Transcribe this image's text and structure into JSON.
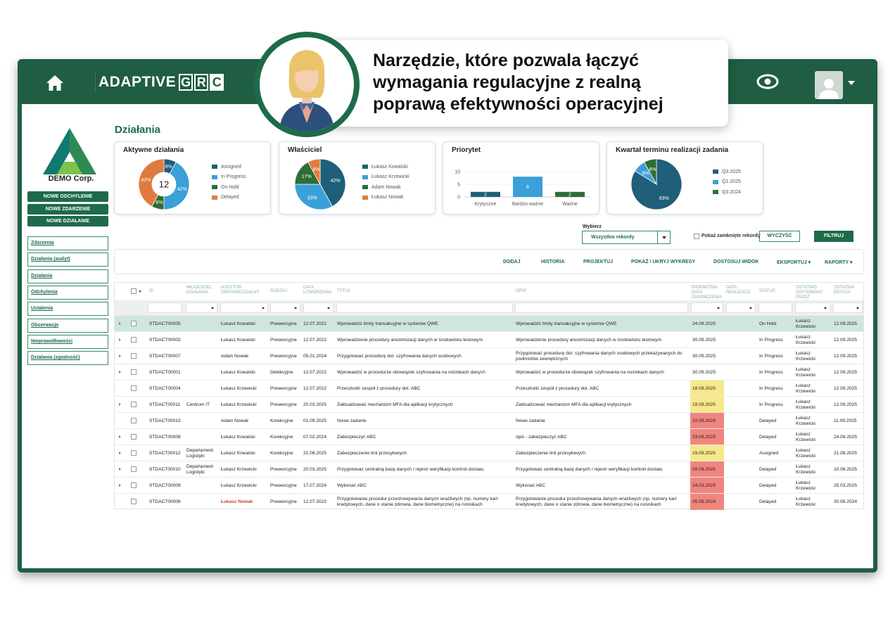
{
  "overlay": {
    "line1": "Narzędzie, które pozwala łączyć",
    "line2": "wymagania regulacyjne z realną",
    "line3": "poprawą efektywności operacyjnej"
  },
  "topbar": {
    "brand": "ADAPTIVE",
    "brand_grc": [
      "G",
      "R",
      "C"
    ]
  },
  "sidebar": {
    "company": "DEMO Corp.",
    "buttons": [
      "NOWE ODCHYLENIE",
      "NOWE ZDARZENIE",
      "NOWE DZIAŁANIE"
    ],
    "links": [
      "Zdarzenia",
      "Działania (audyt)",
      "Działania",
      "Odchylenia",
      "Ustalenia",
      "Obserwacje",
      "Nieprawidłowości",
      "Działania (zgodność)"
    ]
  },
  "page": {
    "title": "Działania"
  },
  "widgets": {
    "active": {
      "title": "Aktywne działania",
      "total": "12",
      "legend": [
        "Assigned",
        "In Progress",
        "On Hold",
        "Delayed"
      ],
      "labels": [
        "8%",
        "42%",
        "8%",
        "42%"
      ]
    },
    "owner": {
      "title": "Właściciel",
      "legend": [
        "Łukasz Kowalski",
        "Łukasz Krzewicki",
        "Adam Nowak",
        "Łukasz Nowak"
      ],
      "labels": [
        "42%",
        "33%",
        "17%",
        "8%"
      ]
    },
    "priority": {
      "title": "Priorytet",
      "categories": [
        "Krytyczne",
        "Bardzo ważne",
        "Ważne"
      ],
      "ticks": [
        "10",
        "5",
        "0"
      ],
      "bar_labels": [
        "2",
        "8",
        "2"
      ]
    },
    "quarter": {
      "title": "Kwartał terminu realizacji zadania",
      "legend": [
        "Q3.2025",
        "Q1.2025",
        "Q3.2024"
      ],
      "labels": [
        "83%",
        "8%",
        "8%"
      ]
    }
  },
  "chart_data": [
    {
      "type": "pie",
      "title": "Aktywne działania",
      "categories": [
        "Assigned",
        "In Progress",
        "On Hold",
        "Delayed"
      ],
      "values": [
        8,
        42,
        8,
        42
      ],
      "center_label": "12",
      "colors": [
        "#1f5f7a",
        "#3aa0d8",
        "#2e6e35",
        "#e07b3f"
      ]
    },
    {
      "type": "pie",
      "title": "Właściciel",
      "categories": [
        "Łukasz Kowalski",
        "Łukasz Krzewicki",
        "Adam Nowak",
        "Łukasz Nowak"
      ],
      "values": [
        42,
        33,
        17,
        8
      ],
      "colors": [
        "#1f5f7a",
        "#3aa0d8",
        "#2e6e35",
        "#e07b3f"
      ]
    },
    {
      "type": "bar",
      "title": "Priorytet",
      "categories": [
        "Krytyczne",
        "Bardzo ważne",
        "Ważne"
      ],
      "values": [
        2,
        8,
        2
      ],
      "ylim": [
        0,
        10
      ],
      "colors": [
        "#1f5f7a",
        "#3aa0d8",
        "#2e6e35"
      ]
    },
    {
      "type": "pie",
      "title": "Kwartał terminu realizacji zadania",
      "categories": [
        "Q3.2025",
        "Q1.2025",
        "Q3.2024"
      ],
      "values": [
        83,
        8,
        8
      ],
      "colors": [
        "#1f5f7a",
        "#3aa0d8",
        "#2e6e35"
      ]
    }
  ],
  "filters": {
    "label": "Wybierz",
    "selected": "Wszystkie rekordy",
    "show_closed": "Pokaż zamknięte rekordy",
    "clear": "WYCZYŚĆ",
    "filter": "FILTRUJ"
  },
  "toolbar": [
    "DODAJ",
    "HISTORIA",
    "PROJEKTUJ",
    "POKAŻ / UKRYJ WYKRESY",
    "DOSTOSUJ WIDOK",
    "EKSPORTUJ ▾",
    "RAPORTY ▾"
  ],
  "table": {
    "headers": [
      "ID",
      "WŁAŚCICIEL DZIAŁANIA",
      "AUDYTOR ODPOWIEDZIALNY",
      "RODZAJ",
      "DATA UTWORZENIA",
      "TYTUŁ",
      "OPIS",
      "PIERWOTNA DATA ZAKOŃCZENIA",
      "DATA REALIZACJI",
      "STATUS",
      "OSTATNIO EDYTOWANY PRZEZ",
      "OSTATNIA EDYCJA"
    ],
    "rows": [
      [
        "STDACT00005",
        "",
        "Łukasz Kowalski",
        "Prewencyjne",
        "12.07.2022",
        "Wprowadzić limity transakcyjne w systemie QWE",
        "Wprowadzić limity transakcyjne w systemie QWE",
        "24.09.2025",
        "",
        "On Hold",
        "Łukasz Krzewicki",
        "12.09.2025"
      ],
      [
        "STDACT00003",
        "",
        "Łukasz Kowalski",
        "Prewencyjne",
        "12.07.2022",
        "Wprowadzenie procedury anonimizacji danych w środowisku testowym",
        "Wprowadzenie procedury anonimizacji danych w środowisku testowym",
        "30.09.2025",
        "",
        "In Progress",
        "Łukasz Krzewicki",
        "12.09.2025"
      ],
      [
        "STDACT00007",
        "",
        "Adam Nowak",
        "Prewencyjne",
        "05.01.2024",
        "Przygotować procedurę dot. szyfrowania danych osobowych",
        "Przygotować procedurę dot. szyfrowania danych osobowych przekazywanych do podmiotów zewnętrznych",
        "30.09.2025",
        "",
        "In Progress",
        "Łukasz Krzewicki",
        "12.09.2025"
      ],
      [
        "STDACT00001",
        "",
        "Łukasz Kowalski",
        "Detekcyjne",
        "12.07.2022",
        "Wprowadzić w procedurze obowiązek szyfrowania na nośnikach danych",
        "Wprowadzić w procedurze obowiązek szyfrowania na nośnikach danych",
        "30.09.2025",
        "",
        "In Progress",
        "Łukasz Krzewicki",
        "12.09.2025"
      ],
      [
        "STDACT00004",
        "",
        "Łukasz Krzewicki",
        "Prewencyjne",
        "12.07.2022",
        "Przeszkolić zespół z procedury dot. ABC",
        "Przeszkolić zespół z procedury dot. ABC",
        "18.09.2025",
        "",
        "In Progress",
        "Łukasz Krzewicki",
        "12.09.2025"
      ],
      [
        "STDACT00011",
        "Centrum IT",
        "Łukasz Krzewicki",
        "Prewencyjne",
        "20.03.2025",
        "Zaktualizować mechanizm MFA dla aplikacji krytycznych",
        "Zaktualizować mechanizm MFA dla aplikacji krytycznych",
        "19.09.2025",
        "",
        "In Progress",
        "Łukasz Krzewicki",
        "12.09.2025"
      ],
      [
        "STDACT00013",
        "",
        "Adam Nowak",
        "Korekcyjne",
        "01.09.2025",
        "Nowe zadanie",
        "Nowe zadanie",
        "10.09.2025",
        "",
        "Delayed",
        "Łukasz Krzewicki",
        "11.09.2025"
      ],
      [
        "STDACT00008",
        "",
        "Łukasz Kowalski",
        "Korekcyjne",
        "07.02.2024",
        "Zabezpieczyć ABC",
        "opis - zabezpieczyć ABC",
        "23.08.2025",
        "",
        "Delayed",
        "Łukasz Krzewicki",
        "24.08.2025"
      ],
      [
        "STDACT00012",
        "Departament Logistyki",
        "Łukasz Kowalski",
        "Korekcyjne",
        "21.08.2025",
        "Zabezpieczenie linii przesyłowych",
        "Zabezpieczenie linii przesyłowych",
        "19.09.2025",
        "",
        "Assigned",
        "Łukasz Krzewicki",
        "21.08.2025"
      ],
      [
        "STDACT00010",
        "Departament Logistyki",
        "Łukasz Krzewicki",
        "Prewencyjne",
        "20.03.2025",
        "Przygotować centralną bazę danych / rejestr weryfikacji kontroli dostaw,",
        "Przygotować centralną bazę danych / rejestr weryfikacji kontroli dostaw,",
        "09.08.2025",
        "",
        "Delayed",
        "Łukasz Krzewicki",
        "10.08.2025"
      ],
      [
        "STDACT00009",
        "",
        "Łukasz Krzewicki",
        "Prewencyjne",
        "17.07.2024",
        "Wykonać ABC",
        "Wykonać ABC",
        "24.03.2025",
        "",
        "Delayed",
        "Łukasz Krzewicki",
        "25.03.2025"
      ],
      [
        "STDACT00006",
        "",
        "Łukasz Nowak",
        "Prewencyjne",
        "12.07.2022",
        "Przygotowanie procedur przechowywania danych wrażliwych (np. numery kart kredytowych, dane o stanie zdrowia, dane biometryczne) na nośnikach",
        "Przygotowanie procedur przechowywania danych wrażliwych (np. numery kart kredytowych, dane o stanie zdrowia, dane biometryczne) na nośnikach",
        "05.08.2024",
        "",
        "Delayed",
        "Łukasz Krzewicki",
        "30.08.2024"
      ]
    ],
    "row_expandable": [
      true,
      true,
      true,
      true,
      false,
      true,
      false,
      true,
      true,
      true,
      true,
      false
    ],
    "date_highlight": [
      "",
      "",
      "",
      "",
      "yellow",
      "yellow",
      "red",
      "red",
      "yellow",
      "red",
      "red",
      "red"
    ]
  }
}
